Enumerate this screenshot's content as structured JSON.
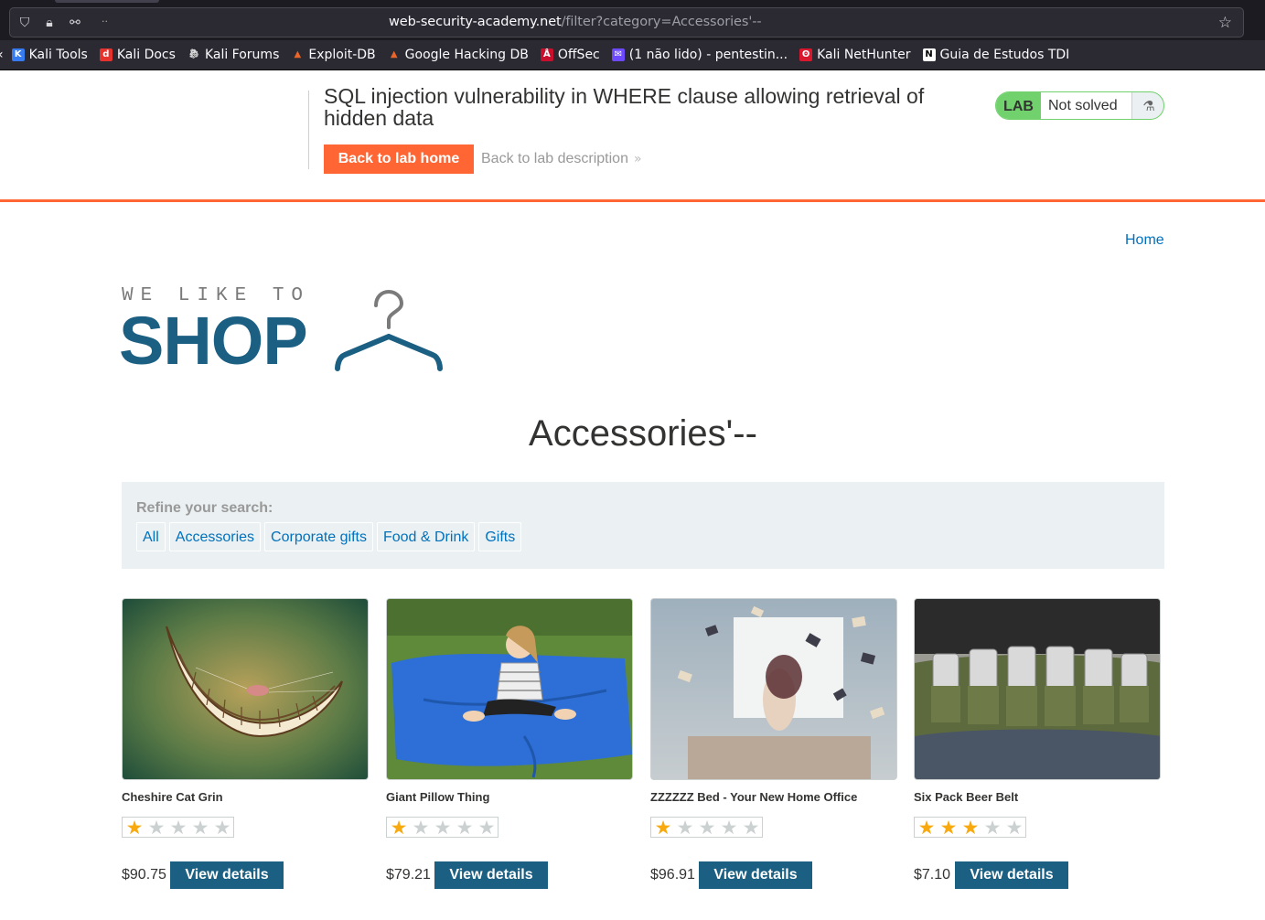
{
  "browser": {
    "url_host": "web-security-academy.net",
    "url_path": "/filter?category=Accessories'--",
    "tab_dots": ".."
  },
  "bookmarks": [
    {
      "label": "Kali Tools",
      "icon": "kali-tools-icon",
      "color": "#367bf0"
    },
    {
      "label": "Kali Docs",
      "icon": "kali-docs-icon",
      "color": "#e5322d"
    },
    {
      "label": "Kali Forums",
      "icon": "kali-forums-icon",
      "color": "#dddddd"
    },
    {
      "label": "Exploit-DB",
      "icon": "exploit-db-icon",
      "color": "#e96529"
    },
    {
      "label": "Google Hacking DB",
      "icon": "ghdb-icon",
      "color": "#e96529"
    },
    {
      "label": "OffSec",
      "icon": "offsec-icon",
      "color": "#c8102e"
    },
    {
      "label": "(1 não lido) - pentestin...",
      "icon": "mail-icon",
      "color": "#6d4aff"
    },
    {
      "label": "Kali NetHunter",
      "icon": "nethunter-icon",
      "color": "#d9182d"
    },
    {
      "label": "Guia de Estudos TDI",
      "icon": "notion-icon",
      "color": "#ffffff"
    }
  ],
  "lab": {
    "title": "SQL injection vulnerability in WHERE clause allowing retrieval of hidden data",
    "back_home": "Back to lab home",
    "back_description": "Back to lab description",
    "tag": "LAB",
    "status": "Not solved",
    "status_color": "#70d16d"
  },
  "nav": {
    "home": "Home"
  },
  "logo": {
    "small": "WE LIKE TO",
    "big": "SHOP"
  },
  "heading": "Accessories'--",
  "filters": {
    "label": "Refine your search:",
    "links": [
      "All",
      "Accessories",
      "Corporate gifts",
      "Food & Drink",
      "Gifts"
    ]
  },
  "products": [
    {
      "name": "Cheshire Cat Grin",
      "rating": 1,
      "price": "$90.75",
      "button": "View details"
    },
    {
      "name": "Giant Pillow Thing",
      "rating": 1,
      "price": "$79.21",
      "button": "View details"
    },
    {
      "name": "ZZZZZZ Bed - Your New Home Office",
      "rating": 1,
      "price": "$96.91",
      "button": "View details"
    },
    {
      "name": "Six Pack Beer Belt",
      "rating": 3,
      "price": "$7.10",
      "button": "View details"
    }
  ],
  "colors": {
    "accent": "#ff6633",
    "brand": "#1b5f82",
    "link": "#0071bc",
    "star": "#f7a90d"
  }
}
